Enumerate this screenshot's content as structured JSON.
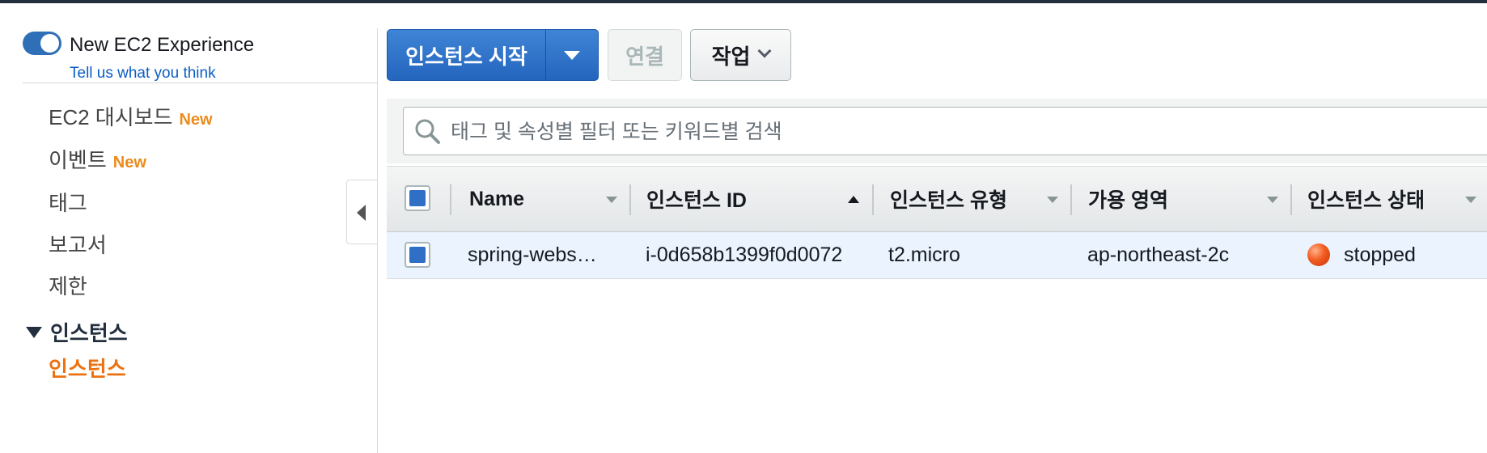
{
  "sidebar": {
    "experience": {
      "toggle_on": true,
      "title": "New EC2 Experience",
      "link": "Tell us what you think"
    },
    "items": [
      {
        "label": "EC2 대시보드",
        "badge": "New"
      },
      {
        "label": "이벤트",
        "badge": "New"
      },
      {
        "label": "태그"
      },
      {
        "label": "보고서"
      },
      {
        "label": "제한"
      }
    ],
    "section": {
      "label": "인스턴스",
      "active_item": "인스턴스"
    }
  },
  "toolbar": {
    "launch_label": "인스턴스 시작",
    "connect_label": "연결",
    "actions_label": "작업"
  },
  "search": {
    "placeholder": "태그 및 속성별 필터 또는 키워드별 검색"
  },
  "table": {
    "columns": [
      "Name",
      "인스턴스 ID",
      "인스턴스 유형",
      "가용 영역",
      "인스턴스 상태"
    ],
    "sorted_column": "인스턴스 ID",
    "rows": [
      {
        "name": "spring-webs…",
        "instance_id": "i-0d658b1399f0d0072",
        "instance_type": "t2.micro",
        "availability_zone": "ap-northeast-2c",
        "state": "stopped"
      }
    ]
  },
  "colors": {
    "primary_button": "#2465be",
    "active_nav": "#ec7211",
    "new_badge": "#ec8b1c",
    "link": "#0a5dc2",
    "status_stopped": "#f25a1f"
  }
}
